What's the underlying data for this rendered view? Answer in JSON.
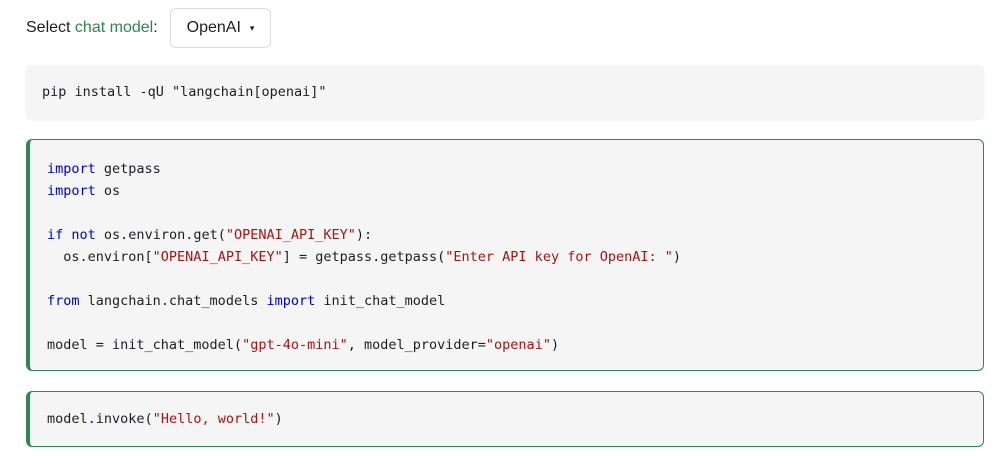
{
  "selector": {
    "prefix": "Select ",
    "link_text": "chat model",
    "suffix": ":",
    "selected_value": "OpenAI",
    "caret": "▾"
  },
  "install_block": {
    "command": "pip install -qU \"langchain[openai]\""
  },
  "code_block": {
    "lines": [
      {
        "k1": "import",
        "t1": " getpass"
      },
      {
        "k1": "import",
        "t1": " os"
      },
      {
        "blank": true
      },
      {
        "k1": "if",
        "sp": " ",
        "k2": "not",
        "t1": " os.environ.get(",
        "s1": "\"OPENAI_API_KEY\"",
        "t2": "):"
      },
      {
        "t0": "  os.environ[",
        "s1": "\"OPENAI_API_KEY\"",
        "t1": "] = getpass.getpass(",
        "s2": "\"Enter API key for OpenAI: \"",
        "t2": ")"
      },
      {
        "blank": true
      },
      {
        "k1": "from",
        "t1": " langchain.chat_models ",
        "k2": "import",
        "t2": " init_chat_model"
      },
      {
        "blank": true
      },
      {
        "t0": "model = init_chat_model(",
        "s1": "\"gpt-4o-mini\"",
        "t1": ", model_provider=",
        "s2": "\"openai\"",
        "t2": ")"
      }
    ]
  },
  "invoke_block": {
    "obj": "model",
    "dot": ".",
    "method": "invoke(",
    "arg": "\"Hello, world!\"",
    "close": ")"
  },
  "colors": {
    "accent": "#2e8555",
    "keyword": "#0000cf",
    "string": "#a31515",
    "code_bg": "#f5f5f5"
  }
}
